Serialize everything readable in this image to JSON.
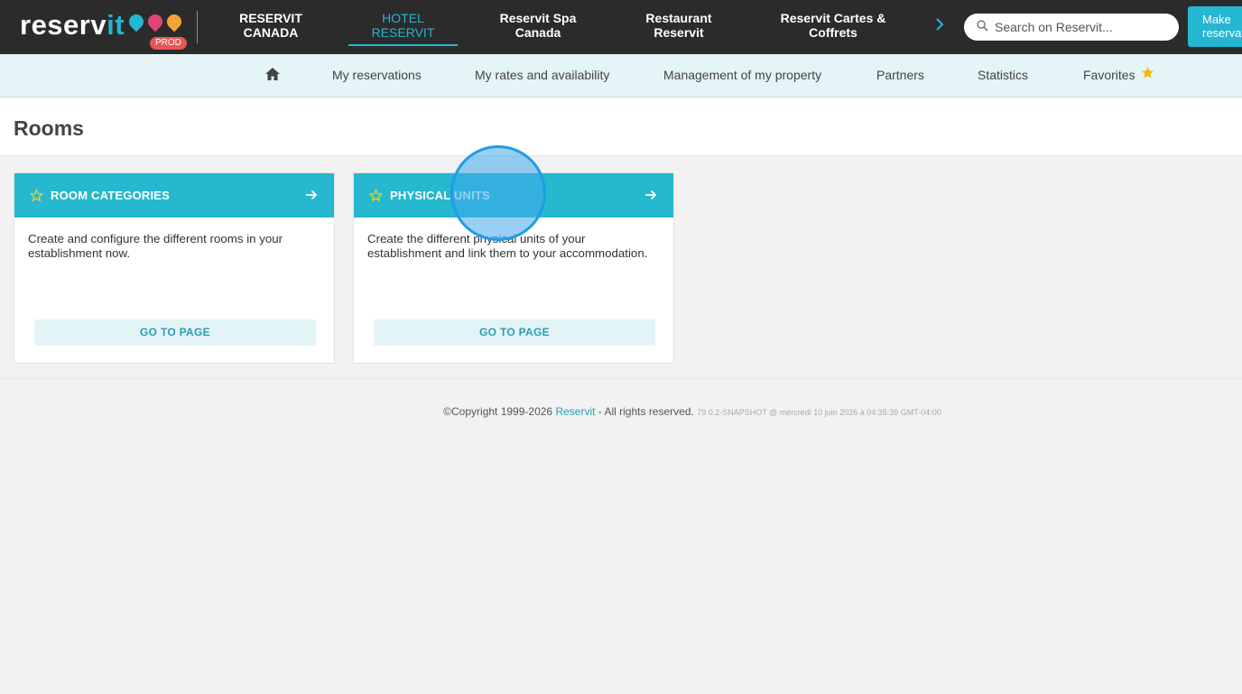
{
  "brand": {
    "logo_main": "reserv",
    "logo_accent": "it",
    "env_badge": "PROD"
  },
  "top_nav": {
    "items": [
      {
        "label_line1": "RESERVIT",
        "label_line2": "CANADA"
      },
      {
        "label_line1": "HOTEL",
        "label_line2": "RESERVIT"
      },
      {
        "label_line1": "Reservit Spa",
        "label_line2": "Canada"
      },
      {
        "label_line1": "Restaurant",
        "label_line2": "Reservit"
      },
      {
        "label_line1": "Reservit Cartes &",
        "label_line2": "Coffrets"
      }
    ],
    "active_index": 1,
    "more_icon": "chevron-right-icon",
    "search_placeholder": "Search on Reservit...",
    "make_button_line1": "Make",
    "make_button_line2": "reservation"
  },
  "sub_nav": {
    "home_icon": "home-icon",
    "items": [
      "My reservations",
      "My rates and availability",
      "Management of my property",
      "Partners",
      "Statistics",
      "Favorites"
    ],
    "favorites_icon": "star-icon"
  },
  "page": {
    "title": "Rooms"
  },
  "cards": [
    {
      "title": "ROOM CATEGORIES",
      "description": "Create and configure the different rooms in your establishment now.",
      "button": "GO TO PAGE"
    },
    {
      "title": "PHYSICAL UNITS",
      "description": "Create the different physical units of your establishment and link them to your accommodation.",
      "button": "GO TO PAGE"
    }
  ],
  "footer": {
    "copyright": "©Copyright 1999-2026",
    "brand": "Reservit",
    "rights": "- All rights reserved.",
    "version": "79.0.2-SNAPSHOT @ mercredi 10 juin 2026 à 04:35:39 GMT-04:00"
  },
  "colors": {
    "accent": "#25b6d2",
    "topbar": "#2b2b2b",
    "subnav": "#e4f4f7",
    "favorite_star": "#f5b70a"
  }
}
